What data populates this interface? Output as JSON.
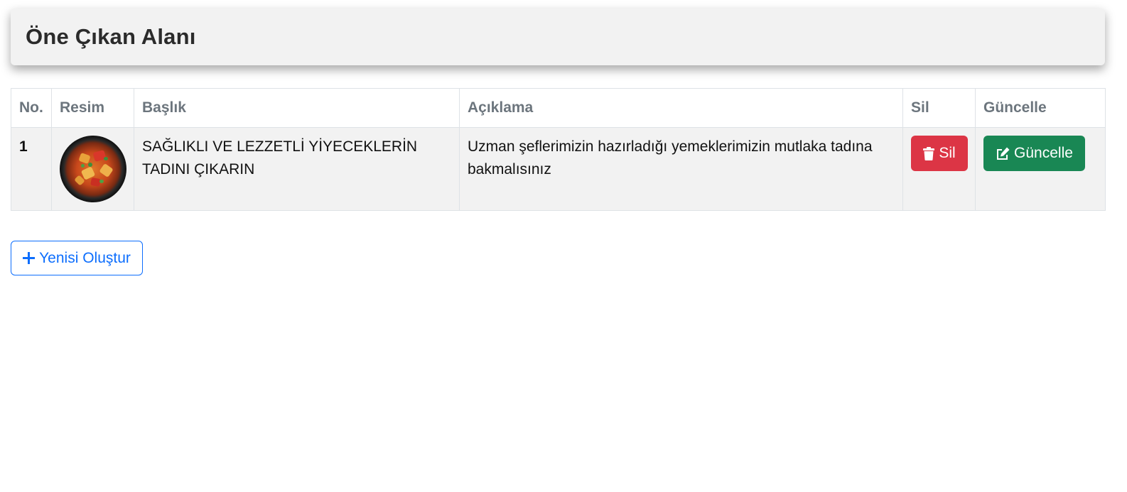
{
  "header": {
    "title": "Öne Çıkan Alanı"
  },
  "table": {
    "columns": [
      "No.",
      "Resim",
      "Başlık",
      "Açıklama",
      "Sil",
      "Güncelle"
    ],
    "rows": [
      {
        "no": "1",
        "image": "food-plate",
        "title": "SAĞLIKLI VE LEZZETLİ YİYECEKLERİN TADINI ÇIKARIN",
        "description": "Uzman şeflerimizin hazırladığı yemeklerimizin mutlaka tadına bakmalısınız",
        "delete_label": "Sil",
        "update_label": "Güncelle"
      }
    ]
  },
  "actions": {
    "create_label": "Yenisi Oluştur"
  },
  "colors": {
    "danger": "#dc3545",
    "success": "#198754",
    "primary": "#0d6efd",
    "header_bg": "#f2f2f2",
    "muted_text": "#6c757d"
  },
  "icons": {
    "delete": "trash-icon",
    "update": "edit-icon",
    "create": "plus-icon"
  }
}
